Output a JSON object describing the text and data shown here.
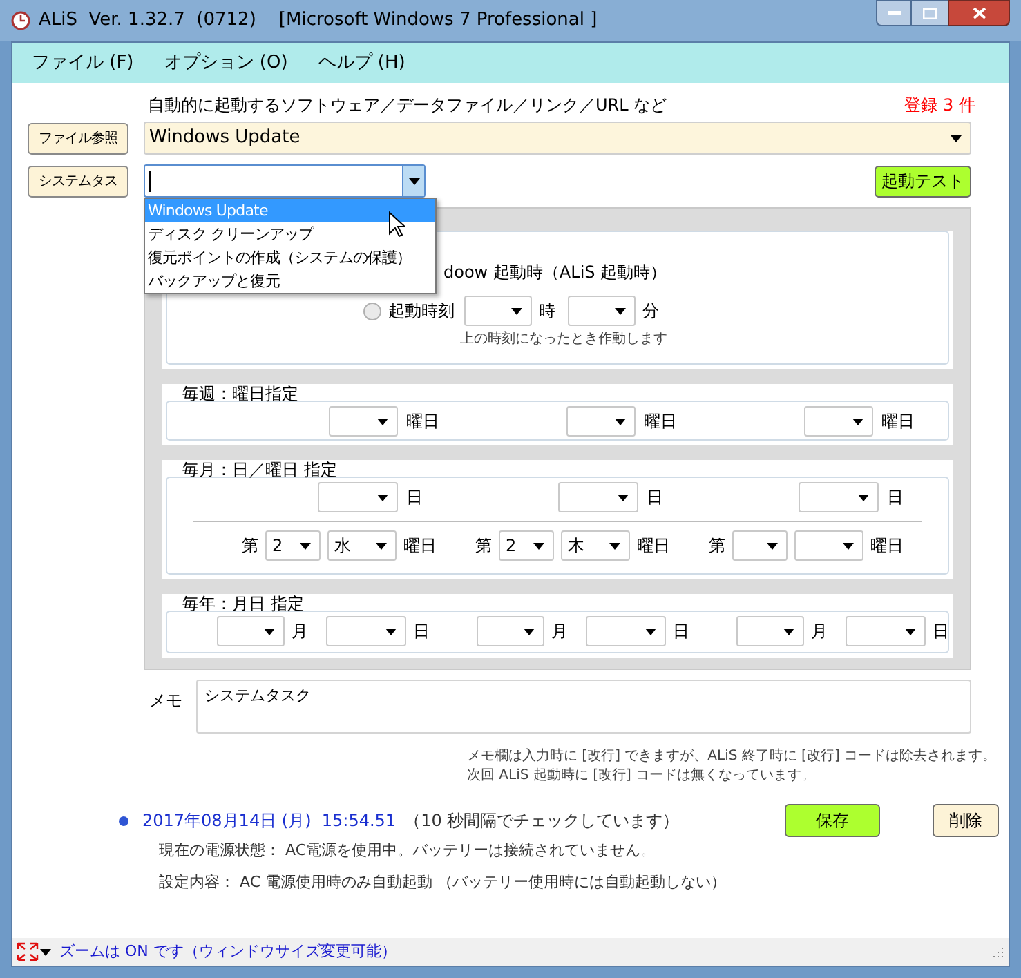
{
  "window": {
    "title": "ALiS  Ver. 1.32.7  (0712)    [Microsoft Windows 7 Professional ]"
  },
  "menu": [
    {
      "label": "ファイル (F)"
    },
    {
      "label": "オプション (O)"
    },
    {
      "label": "ヘルプ (H)"
    }
  ],
  "description": "自動的に起動するソフトウェア／データファイル／リンク／URL など",
  "registered": "登録 3 件",
  "file_button": "ファイル参照",
  "path_combo": {
    "value": "Windows Update"
  },
  "system_button": "システムタス",
  "task_combo": {
    "expanded": true
  },
  "launch_test_button": "起動テスト",
  "dropdown_items": [
    {
      "label": "Windows Update",
      "selected": true
    },
    {
      "label": "ディスク クリーンアップ",
      "selected": false
    },
    {
      "label": "復元ポイントの作成（システムの保護）",
      "selected": false
    },
    {
      "label": "バックアップと復元",
      "selected": false
    }
  ],
  "startup": {
    "partial_text": "doow 起動時（ALiS 起動時）",
    "radio": {
      "label": "起動時刻",
      "checked": false
    },
    "hour_unit": "時",
    "minute_unit": "分",
    "hint": "上の時刻になったとき作動します"
  },
  "weekly": {
    "title": "毎週：曜日指定",
    "slots": [
      {
        "unit": "曜日"
      },
      {
        "unit": "曜日"
      },
      {
        "unit": "曜日"
      }
    ]
  },
  "monthly": {
    "title": "毎月：日／曜日 指定",
    "days": [
      {
        "unit": "日"
      },
      {
        "unit": "日"
      },
      {
        "unit": "日"
      }
    ],
    "weekdays": [
      {
        "prefix": "第",
        "week": "2",
        "day": "水",
        "unit": "曜日"
      },
      {
        "prefix": "第",
        "week": "2",
        "day": "木",
        "unit": "曜日"
      },
      {
        "prefix": "第",
        "unit": "曜日"
      }
    ]
  },
  "yearly": {
    "title": "毎年：月日 指定",
    "dates": [
      {
        "month_unit": "月",
        "day_unit": "日"
      },
      {
        "month_unit": "月",
        "day_unit": "日"
      },
      {
        "month_unit": "月",
        "day_unit": "日"
      }
    ]
  },
  "memo": {
    "label": "メモ",
    "value": "システムタスク"
  },
  "memo_note": [
    "メモ欄は入力時に [改行] できますが、ALiS 終了時に [改行] コードは除去されます。",
    "次回 ALiS 起動時に [改行] コードは無くなっています。"
  ],
  "status": {
    "datetime": "2017年08月14日 (月)  15:54.51",
    "interval": "（10 秒間隔でチェックしています）",
    "power": "現在の電源状態： AC電源を使用中。バッテリーは接続されていません。",
    "setting": "設定内容： AC 電源使用時のみ自動起動 （バッテリー使用時には自動起動しない）"
  },
  "save_button": "保存",
  "delete_button": "削除",
  "status_bar": {
    "text": "ズームは ON です（ウィンドウサイズ変更可能）"
  }
}
